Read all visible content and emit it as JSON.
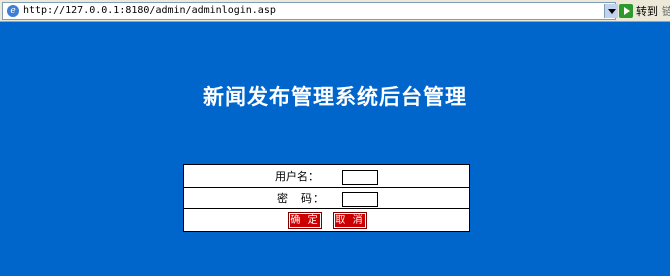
{
  "browser": {
    "address_url": "http://127.0.0.1:8180/admin/adminlogin.asp",
    "go_label": "转到",
    "links_label": "链"
  },
  "page": {
    "title": "新闻发布管理系统后台管理",
    "background_color": "#0066cc"
  },
  "login": {
    "username_label": "用户名：",
    "password_label": "密　码：",
    "username_value": "",
    "password_value": "",
    "submit_label": "确 定",
    "cancel_label": "取 消",
    "button_color": "#cc0000"
  }
}
